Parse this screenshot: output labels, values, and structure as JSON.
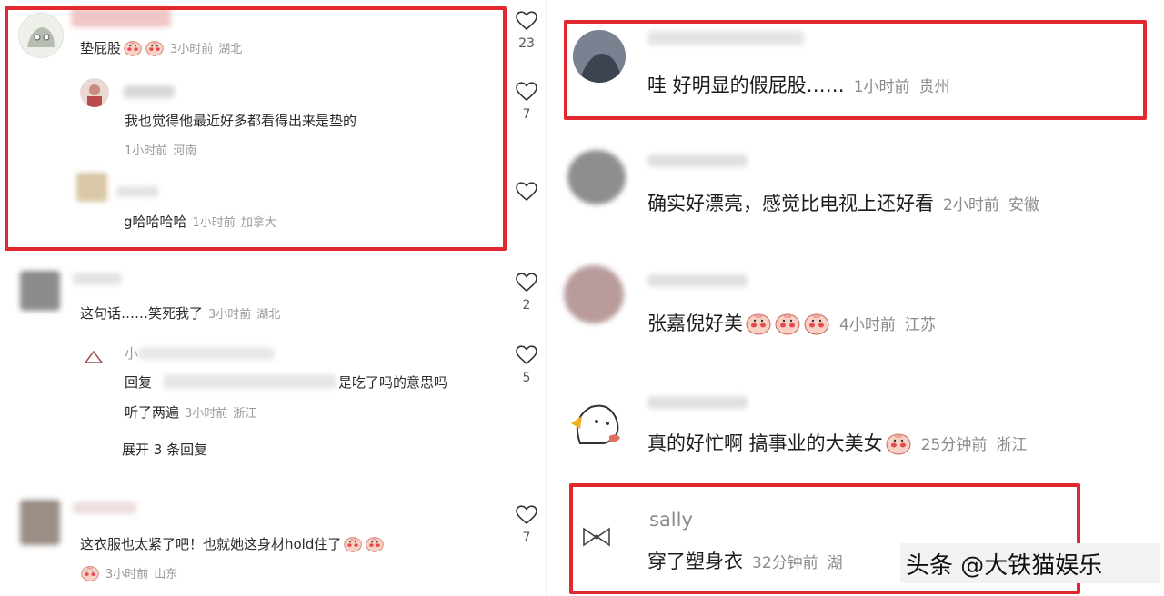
{
  "left": {
    "c1": {
      "text": "垫屁股",
      "time": "3小时前",
      "place": "湖北",
      "likes": "23"
    },
    "c1_r1": {
      "text": "我也觉得他最近好多都看得出来是垫的",
      "time": "1小时前",
      "place": "河南",
      "likes": "7"
    },
    "c1_r2": {
      "text": "g哈哈哈哈",
      "time": "1小时前",
      "place": "加拿大"
    },
    "c2": {
      "text": "这句话……笑死我了",
      "time": "3小时前",
      "place": "湖北",
      "likes": "2"
    },
    "c2_r1": {
      "name": "小",
      "reply_prefix": "回复",
      "reply_suffix": "是吃了吗的意思吗",
      "line2": "听了两遍",
      "time": "3小时前",
      "place": "浙江",
      "likes": "5"
    },
    "c2_expand": "展开 3 条回复",
    "c3": {
      "text": "这衣服也太紧了吧！也就她这身材hold住了",
      "time": "3小时前",
      "place": "山东",
      "likes": "7"
    }
  },
  "right": {
    "r1": {
      "text": "哇  好明显的假屁股……",
      "time": "1小时前",
      "place": "贵州"
    },
    "r2": {
      "text": "确实好漂亮，感觉比电视上还好看",
      "time": "2小时前",
      "place": "安徽"
    },
    "r3": {
      "text": "张嘉倪好美",
      "time": "4小时前",
      "place": "江苏"
    },
    "r4": {
      "text": "真的好忙啊 搞事业的大美女",
      "time": "25分钟前",
      "place": "浙江"
    },
    "r5": {
      "name": "sally",
      "text": "穿了塑身衣",
      "time": "32分钟前",
      "place": "湖"
    }
  },
  "watermark": "头条 @大铁猫娱乐",
  "colors": {
    "highlight": "#e0282e",
    "meta": "#8d8d8d",
    "heart": "#333333"
  },
  "icons": [
    "heart-icon",
    "peach-emoji-icon",
    "bow-icon"
  ]
}
